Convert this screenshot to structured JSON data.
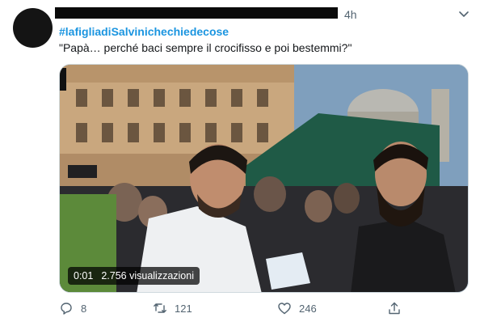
{
  "tweet": {
    "time": "4h",
    "hashtag": "#lafigliadiSalvinichechiedecose",
    "text": "\"Papà… perché baci sempre il crocifisso e poi bestemmi?\"",
    "video": {
      "elapsed": "0:01",
      "views": "2.756 visualizzazioni"
    },
    "actions": {
      "reply_icon": "comment-icon",
      "replies": "8",
      "retweet_icon": "retweet-icon",
      "retweets": "121",
      "like_icon": "heart-icon",
      "likes": "246",
      "share_icon": "share-icon"
    },
    "colors": {
      "hashtag": "#1b95e0",
      "secondary_text": "#536471"
    }
  }
}
